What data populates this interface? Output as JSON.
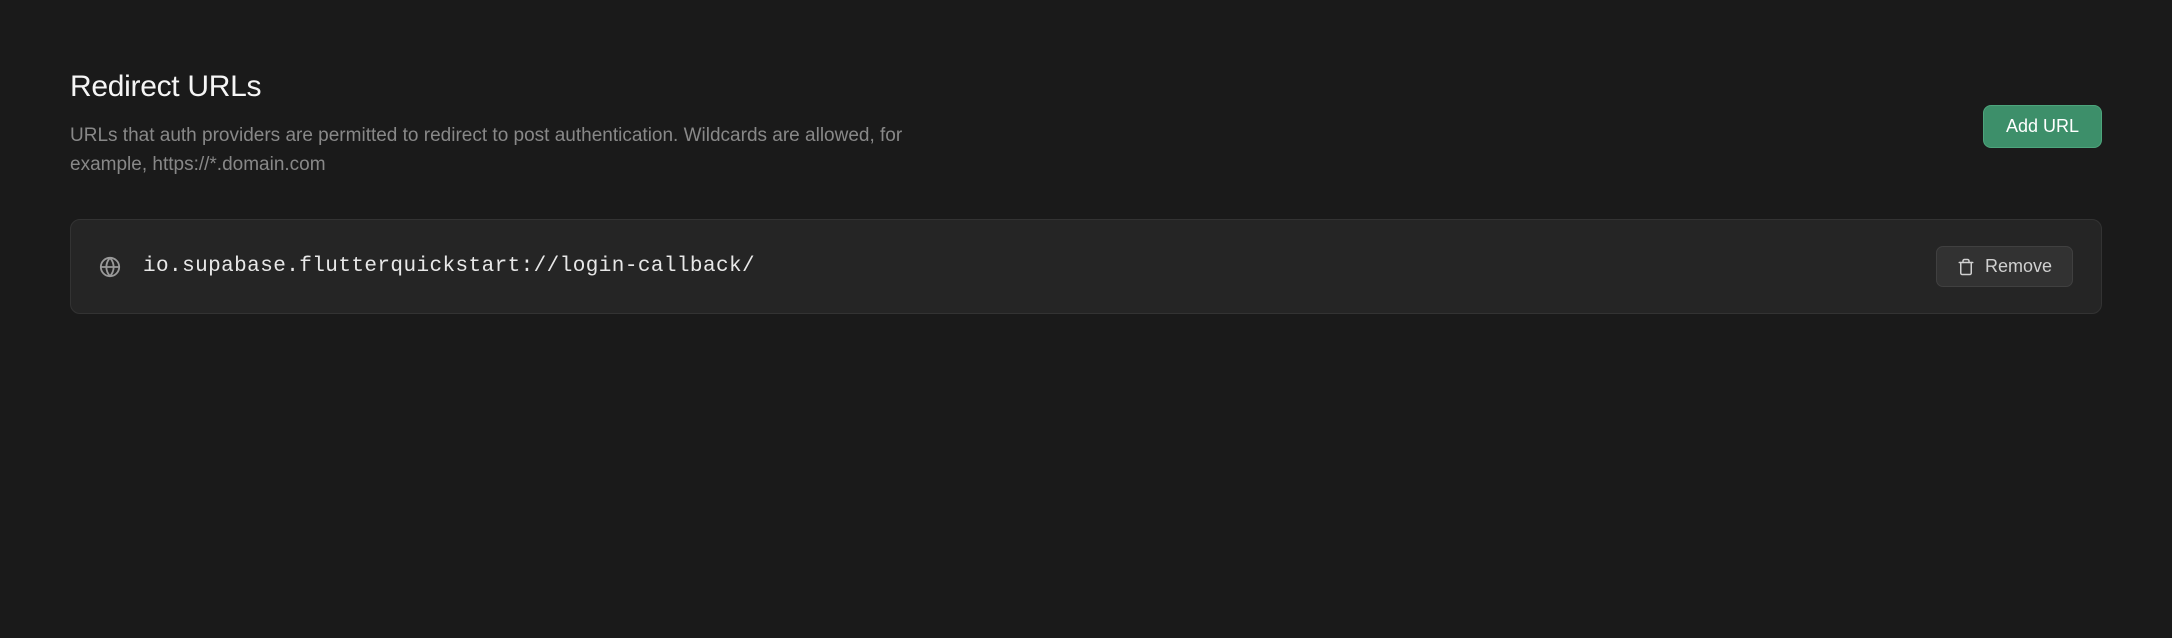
{
  "header": {
    "title": "Redirect URLs",
    "description": "URLs that auth providers are permitted to redirect to post authentication. Wildcards are allowed, for example, https://*.domain.com",
    "add_button_label": "Add URL"
  },
  "urls": [
    {
      "value": "io.supabase.flutterquickstart://login-callback/",
      "remove_label": "Remove"
    }
  ],
  "colors": {
    "background": "#1a1a1a",
    "card_background": "#252525",
    "accent_green": "#3d8f6a",
    "text_primary": "#f5f5f5",
    "text_secondary": "#888888"
  }
}
